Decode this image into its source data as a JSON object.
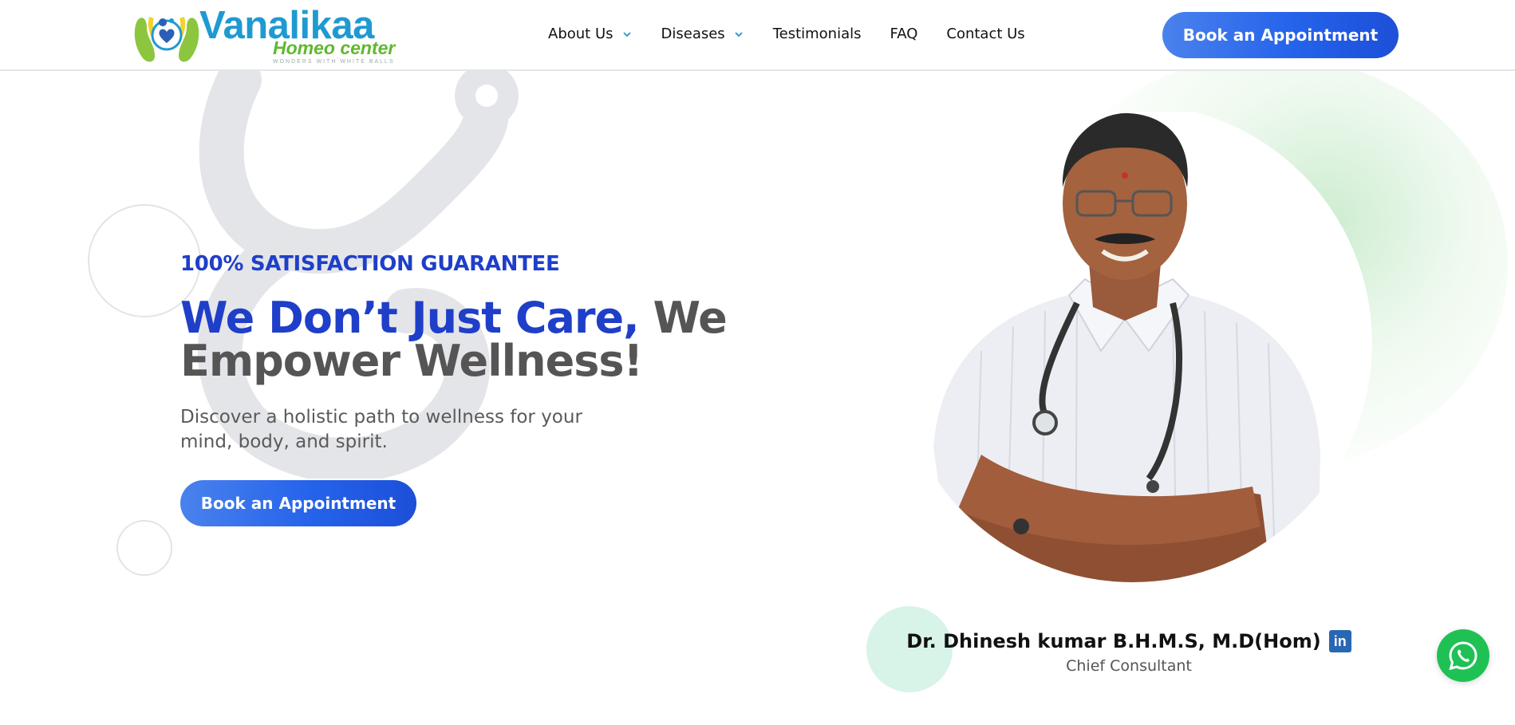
{
  "brand": {
    "name": "Vanalikaa",
    "subtitle": "Homeo center",
    "tagline": "WONDERS WITH WHITE BALLS",
    "logo_icon": "logo-hands-heart-icon",
    "primary_color": "#1f9ad1",
    "secondary_color": "#5fb82e"
  },
  "nav": {
    "items": [
      {
        "label": "About Us",
        "has_dropdown": true
      },
      {
        "label": "Diseases",
        "has_dropdown": true
      },
      {
        "label": "Testimonials",
        "has_dropdown": false
      },
      {
        "label": "FAQ",
        "has_dropdown": false
      },
      {
        "label": "Contact Us",
        "has_dropdown": false
      }
    ],
    "cta_label": "Book an Appointment"
  },
  "hero": {
    "eyebrow": "100% SATISFACTION GUARANTEE",
    "headline_accent": "We Don’t Just Care,",
    "headline_rest": " We Empower Wellness!",
    "subtext": "Discover a holistic path to wellness for your mind, body, and spirit.",
    "cta_label": "Book an Appointment",
    "accent_color": "#1f3fc9",
    "button_color": "#2563eb"
  },
  "doctor": {
    "name": "Dr. Dhinesh kumar B.H.M.S, M.D(Hom)",
    "role": "Chief Consultant",
    "social_icon": "linkedin-icon",
    "social_icon_label": "in"
  },
  "floating": {
    "icon": "whatsapp-icon",
    "color": "#1fc155"
  }
}
